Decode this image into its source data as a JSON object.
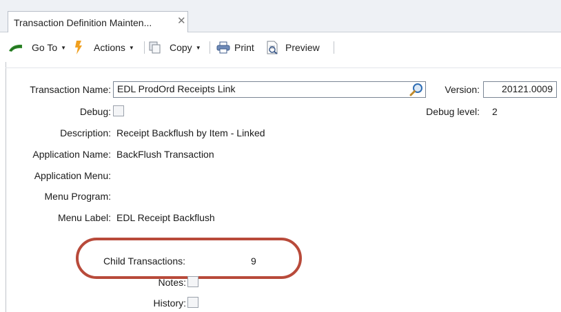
{
  "tab": {
    "title": "Transaction Definition Mainten...",
    "close_glyph": "✕"
  },
  "toolbar": {
    "goto_label": "Go To",
    "actions_label": "Actions",
    "copy_label": "Copy",
    "print_label": "Print",
    "preview_label": "Preview"
  },
  "form": {
    "transaction_name_label": "Transaction Name:",
    "transaction_name_value": "EDL ProdOrd Receipts Link",
    "version_label": "Version:",
    "version_value": "20121.0009",
    "debug_label": "Debug:",
    "debug_level_label": "Debug level:",
    "debug_level_value": "2",
    "description_label": "Description:",
    "description_value": "Receipt Backflush by Item - Linked",
    "application_name_label": "Application Name:",
    "application_name_value": "BackFlush Transaction",
    "application_menu_label": "Application Menu:",
    "menu_program_label": "Menu Program:",
    "menu_label_label": "Menu Label:",
    "menu_label_value": "EDL Receipt Backflush",
    "child_transactions_label": "Child Transactions:",
    "child_transactions_value": "9",
    "notes_label": "Notes:",
    "history_label": "History:"
  },
  "colors": {
    "highlight": "#b84a3a",
    "accent_green": "#2f8a2a",
    "accent_orange": "#f0a020"
  }
}
